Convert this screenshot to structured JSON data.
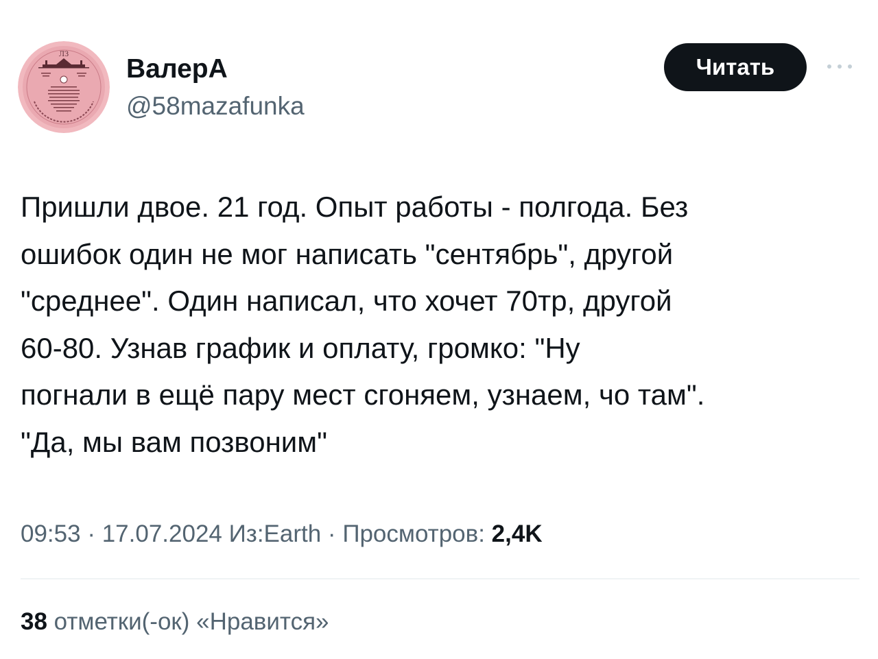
{
  "author": {
    "display_name": "ВалерА",
    "handle": "@58mazafunka"
  },
  "follow_button": {
    "label": "Читать"
  },
  "more_icon": "more-horizontal-icon",
  "tweet": {
    "text": "Пришли двое. 21 год. Опыт работы - полгода. Без\nошибок один не мог написать \"сентябрь\", другой\n\"среднее\". Один написал, что хочет 70тр, другой\n60-80.  Узнав график и оплату, громко: \"Ну\nпогнали в ещё пару мест сгоняем, узнаем, чо там\".\n \"Да, мы вам позвоним\""
  },
  "meta": {
    "time": "09:53",
    "separator": " · ",
    "date": "17.07.2024",
    "source": "Из:Earth",
    "views_label": "Просмотров: ",
    "views_count": "2,4K"
  },
  "likes": {
    "count": "38",
    "label": " отметки(-ок) «Нравится»"
  },
  "colors": {
    "text_primary": "#0f1419",
    "text_secondary": "#536471",
    "button_bg": "#0f1419",
    "button_text": "#ffffff",
    "divider": "#eff3f4",
    "avatar_pink": "#eaa9b1"
  }
}
